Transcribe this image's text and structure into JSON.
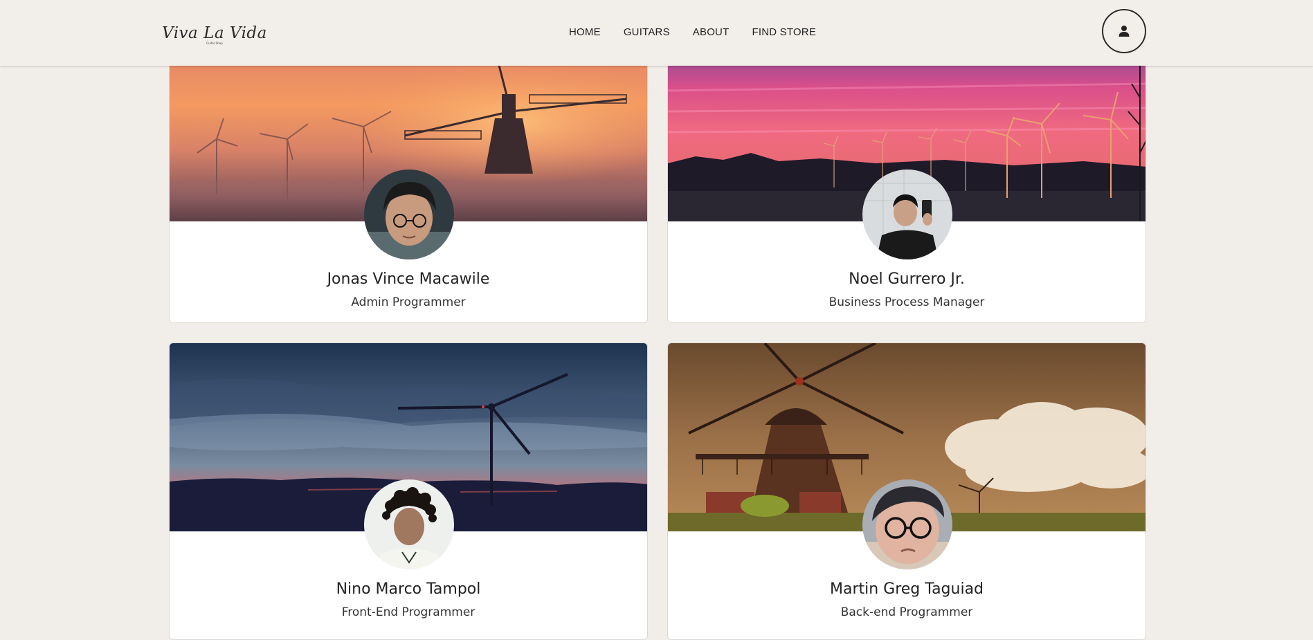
{
  "brand": {
    "name": "Viva La Vida",
    "tagline": "Guitar Shop"
  },
  "nav": {
    "items": [
      {
        "label": "HOME"
      },
      {
        "label": "GUITARS"
      },
      {
        "label": "ABOUT"
      },
      {
        "label": "FIND STORE"
      }
    ],
    "profile_icon": "user-icon"
  },
  "team": [
    {
      "name": "Jonas Vince Macawile",
      "role": "Admin Programmer",
      "banner": "orange-sunset-windmill",
      "avatar": "boy-glasses-dark"
    },
    {
      "name": "Noel Gurrero Jr.",
      "role": "Business Process Manager",
      "banner": "pink-sky-wind-turbines",
      "avatar": "mirror-selfie"
    },
    {
      "name": "Nino Marco Tampol",
      "role": "Front-End Programmer",
      "banner": "blue-night-turbine",
      "avatar": "curly-hair-portrait"
    },
    {
      "name": "Martin Greg Taguiad",
      "role": "Back-end Programmer",
      "banner": "sepia-dutch-windmill",
      "avatar": "glasses-selfie"
    }
  ],
  "colors": {
    "page_bg": "#f1eeea",
    "header_bg": "#f2efeb",
    "card_bg": "#ffffff",
    "text": "#222222"
  }
}
